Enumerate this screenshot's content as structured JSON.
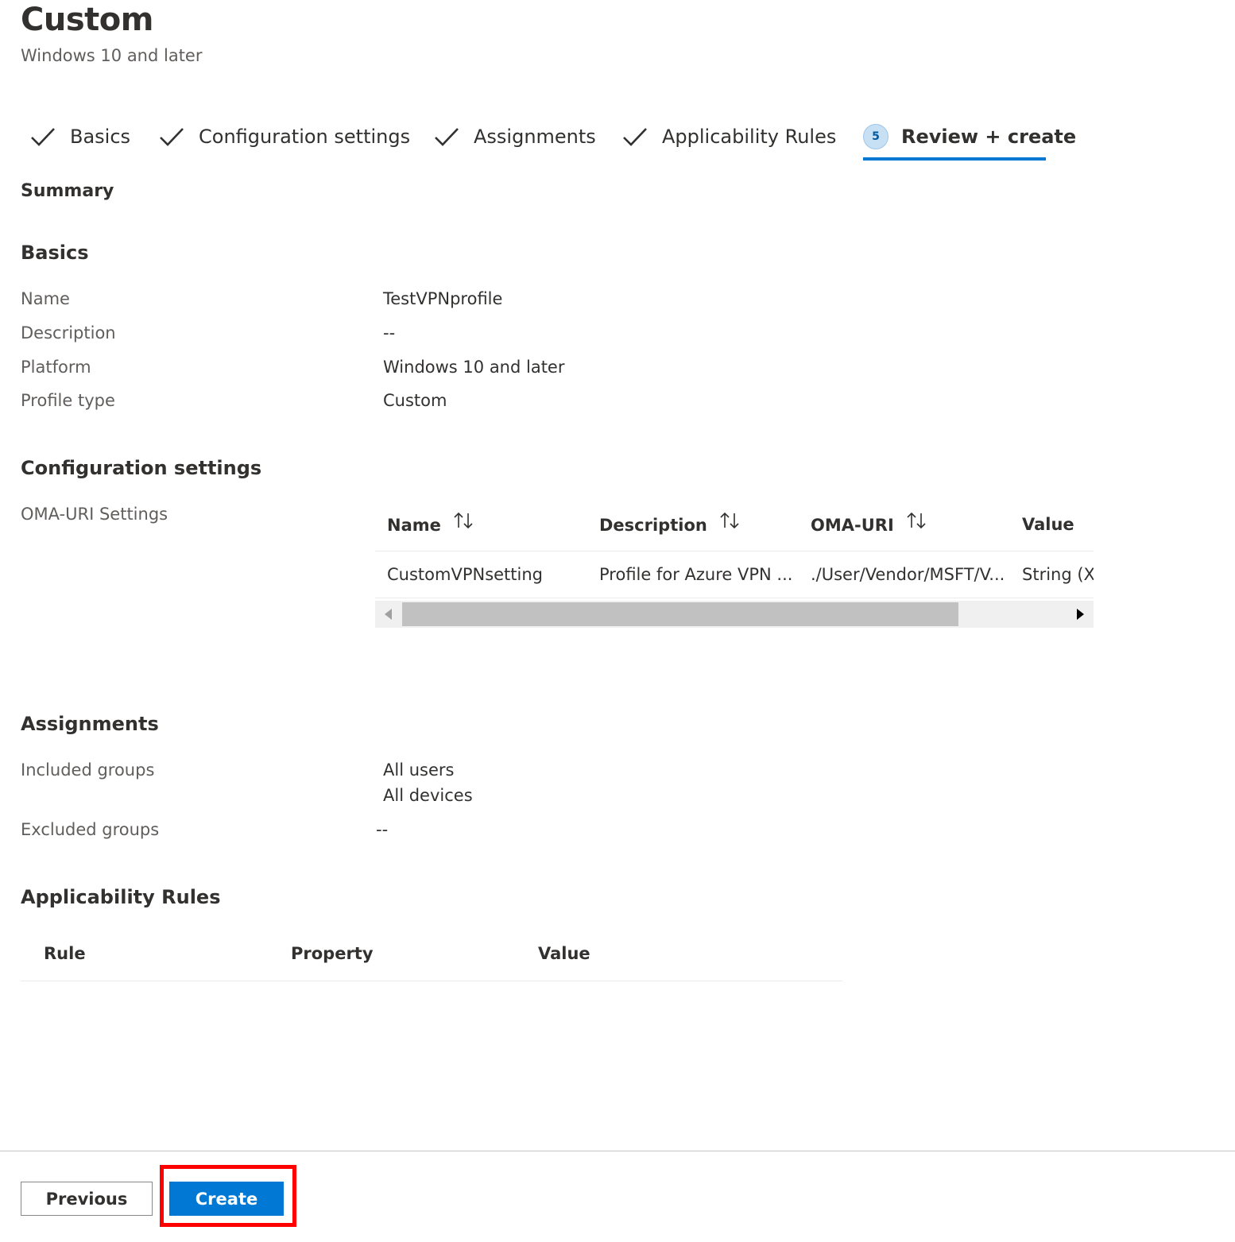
{
  "header": {
    "title": "Custom",
    "subtitle": "Windows 10 and later"
  },
  "steps": [
    {
      "label": "Basics",
      "status": "complete"
    },
    {
      "label": "Configuration settings",
      "status": "complete"
    },
    {
      "label": "Assignments",
      "status": "complete"
    },
    {
      "label": "Applicability Rules",
      "status": "complete"
    },
    {
      "label": "Review + create",
      "status": "active",
      "number": "5"
    }
  ],
  "summary_label": "Summary",
  "basics": {
    "title": "Basics",
    "rows": [
      {
        "label": "Name",
        "value": "TestVPNprofile"
      },
      {
        "label": "Description",
        "value": "--"
      },
      {
        "label": "Platform",
        "value": "Windows 10 and later"
      },
      {
        "label": "Profile type",
        "value": "Custom"
      }
    ]
  },
  "configuration": {
    "title": "Configuration settings",
    "oma_label": "OMA-URI Settings",
    "table": {
      "columns": [
        "Name",
        "Description",
        "OMA-URI",
        "Value"
      ],
      "rows": [
        [
          "CustomVPNsetting",
          "Profile for Azure VPN ...",
          "./User/Vendor/MSFT/V...",
          "String (XI"
        ]
      ]
    }
  },
  "assignments": {
    "title": "Assignments",
    "included_label": "Included groups",
    "included_values": [
      "All users",
      "All devices"
    ],
    "excluded_label": "Excluded groups",
    "excluded_value": "--"
  },
  "applicability": {
    "title": "Applicability Rules",
    "columns": [
      "Rule",
      "Property",
      "Value"
    ]
  },
  "footer": {
    "previous_label": "Previous",
    "create_label": "Create"
  },
  "colors": {
    "accent": "#0078d4",
    "highlight": "#ff0000",
    "step_badge": "#c7e0f4"
  },
  "icons": {
    "completed_step": "check-icon",
    "sort": "sort-arrows-icon"
  }
}
